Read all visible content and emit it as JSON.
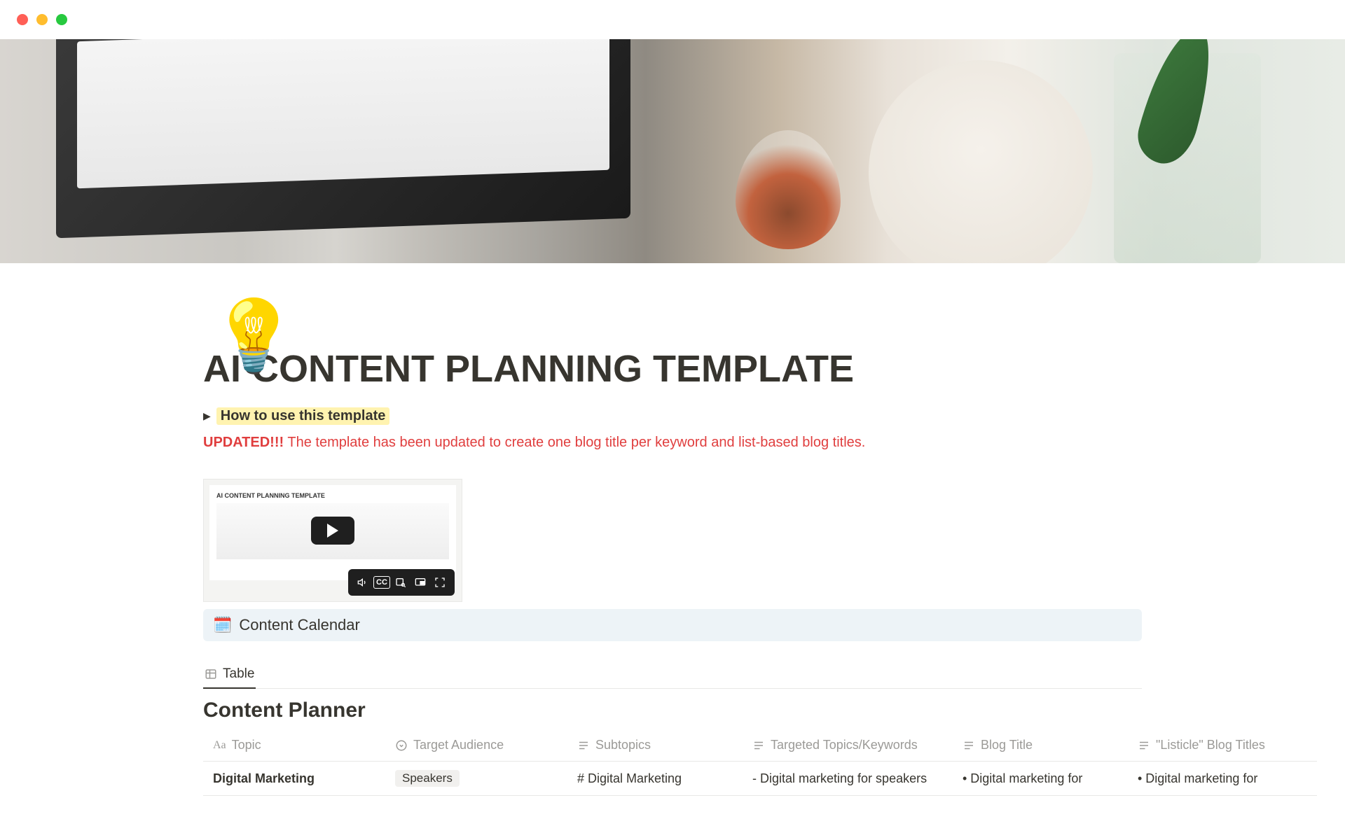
{
  "page": {
    "icon": "💡",
    "title": "AI CONTENT PLANNING TEMPLATE",
    "toggle_label": "How to use this template",
    "update_prefix": "UPDATED!!!",
    "update_text": " The template has been updated to create one blog title per keyword and list-based blog titles."
  },
  "video": {
    "thumb_title": "AI CONTENT PLANNING TEMPLATE",
    "controls": {
      "volume": "volume-icon",
      "cc": "CC",
      "search": "search-icon",
      "pip": "pip-icon",
      "fullscreen": "fullscreen-icon"
    }
  },
  "calendar_link": {
    "emoji": "🗓️",
    "label": "Content Calendar"
  },
  "tabs": {
    "table_label": "Table"
  },
  "planner": {
    "title": "Content Planner",
    "columns": {
      "topic": "Topic",
      "audience": "Target Audience",
      "subtopics": "Subtopics",
      "keywords": "Targeted Topics/Keywords",
      "blog_title": "Blog Title",
      "listicle": "\"Listicle\" Blog Titles"
    },
    "rows": [
      {
        "topic": "Digital Marketing",
        "audience": "Speakers",
        "subtopics": "# Digital Marketing",
        "keywords": "- Digital marketing for speakers",
        "blog_title": "• Digital marketing for",
        "listicle": "• Digital marketing for"
      }
    ]
  }
}
